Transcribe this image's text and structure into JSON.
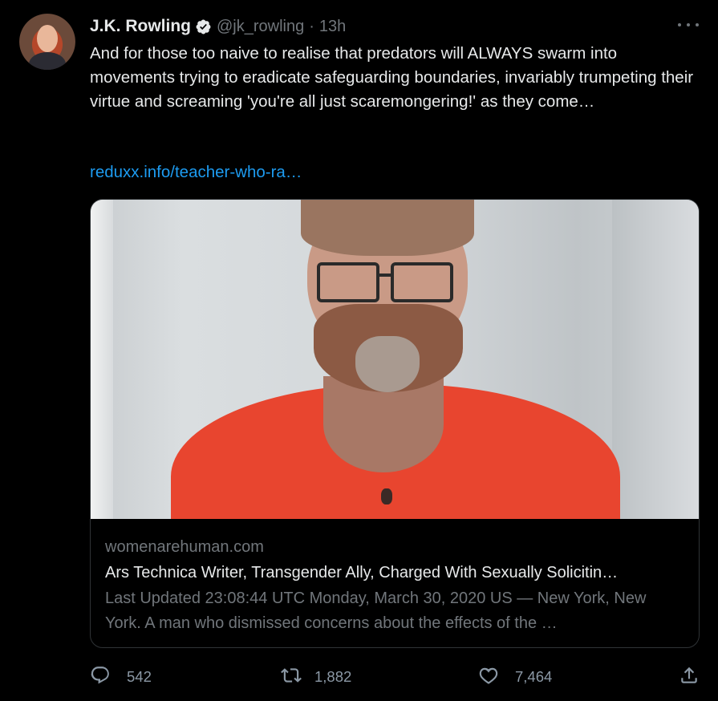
{
  "author": {
    "name": "J.K. Rowling",
    "handle": "@jk_rowling",
    "separator": "·",
    "time": "13h",
    "verified": true
  },
  "tweet": {
    "text": "And for those too naive to realise that predators will ALWAYS swarm into movements trying to eradicate safeguarding boundaries, invariably trumpeting their virtue and screaming 'you're all just scaremongering!' as they come…",
    "link": "reduxx.info/teacher-who-ra…"
  },
  "card": {
    "domain": "womenarehuman.com",
    "title": "Ars Technica Writer, Transgender Ally, Charged With Sexually Solicitin…",
    "description": "Last Updated 23:08:44 UTC Monday, March 30, 2020 US — New York, New York. A man who dismissed concerns about the effects of the …"
  },
  "actions": {
    "replies": "542",
    "retweets": "1,882",
    "likes": "7,464"
  },
  "icons": {
    "verified": "verified-badge-icon",
    "more": "more-options-icon",
    "reply": "reply-icon",
    "retweet": "retweet-icon",
    "like": "heart-icon",
    "share": "share-icon"
  },
  "colors": {
    "background": "#000000",
    "text": "#e7e9ea",
    "secondary": "#71767b",
    "link": "#1d9bf0",
    "border": "#2f3336"
  }
}
